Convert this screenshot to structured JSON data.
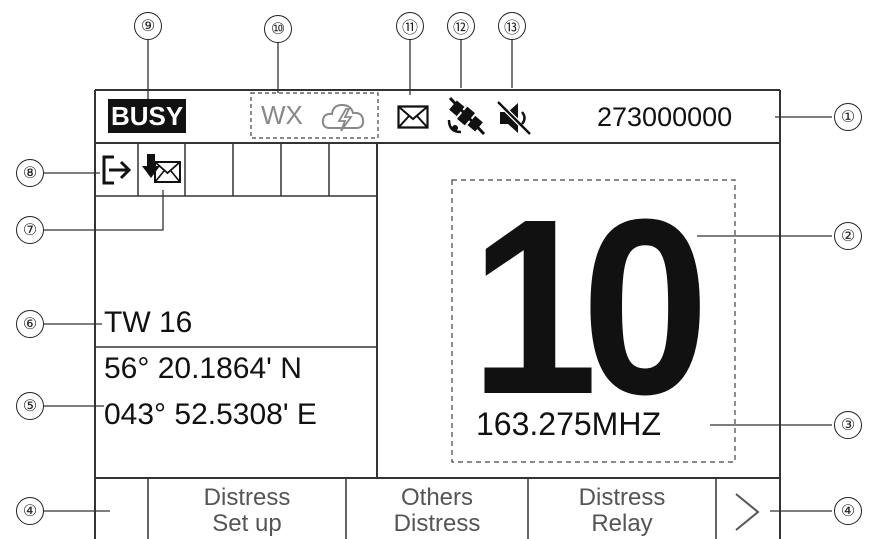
{
  "status_bar": {
    "busy": "BUSY",
    "wx": "WX",
    "mmsi": "273000000"
  },
  "channel_panel": {
    "channel": "10",
    "frequency": "163.275MHZ"
  },
  "left_panel": {
    "tw_label": "TW 16",
    "latitude": "56° 20.1864' N",
    "longitude": "043° 52.5308' E"
  },
  "softkeys": [
    {
      "line1": "Distress",
      "line2": "Set up"
    },
    {
      "line1": "Others",
      "line2": "Distress"
    },
    {
      "line1": "Distress",
      "line2": "Relay"
    }
  ],
  "callouts": [
    "①",
    "②",
    "③",
    "④",
    "⑤",
    "⑥",
    "⑦",
    "⑧",
    "⑨",
    "⑩",
    "⑪",
    "⑫",
    "⑬"
  ],
  "icons": {
    "cloud": "cloud-lightning-icon",
    "mail": "envelope-icon",
    "gps": "gps-off-icon",
    "speaker": "speaker-mute-icon",
    "exit": "exit-arrow-icon",
    "incoming": "incoming-mail-icon",
    "next": "chevron-right-icon"
  }
}
